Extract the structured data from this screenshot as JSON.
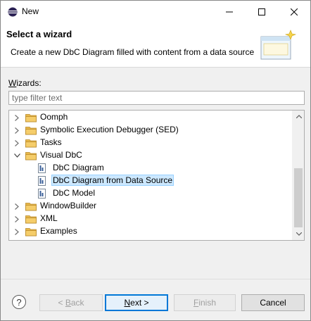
{
  "window": {
    "title": "New"
  },
  "banner": {
    "title": "Select a wizard",
    "description": "Create a new DbC Diagram filled with content from a data source"
  },
  "wizards_label_mnemonic": "W",
  "wizards_label_rest": "izards:",
  "filter": {
    "placeholder": "type filter text",
    "value": ""
  },
  "tree": {
    "items": [
      {
        "label": "Oomph",
        "type": "folder",
        "expanded": false,
        "depth": 0
      },
      {
        "label": "Symbolic Execution Debugger (SED)",
        "type": "folder",
        "expanded": false,
        "depth": 0
      },
      {
        "label": "Tasks",
        "type": "folder",
        "expanded": false,
        "depth": 0
      },
      {
        "label": "Visual DbC",
        "type": "folder",
        "expanded": true,
        "depth": 0
      },
      {
        "label": "DbC Diagram",
        "type": "file",
        "depth": 1
      },
      {
        "label": "DbC Diagram from Data Source",
        "type": "file",
        "depth": 1,
        "selected": true
      },
      {
        "label": "DbC Model",
        "type": "file",
        "depth": 1
      },
      {
        "label": "WindowBuilder",
        "type": "folder",
        "expanded": false,
        "depth": 0
      },
      {
        "label": "XML",
        "type": "folder",
        "expanded": false,
        "depth": 0
      },
      {
        "label": "Examples",
        "type": "folder",
        "expanded": false,
        "depth": 0
      }
    ]
  },
  "buttons": {
    "help": "?",
    "back_pre": "< ",
    "back_mn": "B",
    "back_post": "ack",
    "next_mn": "N",
    "next_post": "ext >",
    "finish_mn": "F",
    "finish_post": "inish",
    "cancel": "Cancel"
  },
  "colors": {
    "selection_bg": "#cce8ff",
    "default_button_border": "#0078d7",
    "folder": "#e8b84a"
  }
}
